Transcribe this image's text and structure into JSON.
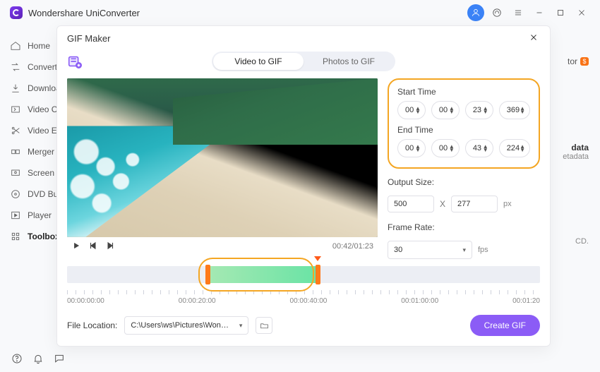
{
  "app": {
    "title": "Wondershare UniConverter"
  },
  "nav": {
    "items": [
      {
        "label": "Home",
        "name": "home"
      },
      {
        "label": "Converter",
        "name": "converter"
      },
      {
        "label": "Downloader",
        "name": "downloader"
      },
      {
        "label": "Video Compressor",
        "name": "video-compressor"
      },
      {
        "label": "Video Editor",
        "name": "video-editor"
      },
      {
        "label": "Merger",
        "name": "merger"
      },
      {
        "label": "Screen Recorder",
        "name": "screen-recorder"
      },
      {
        "label": "DVD Burner",
        "name": "dvd-burner"
      },
      {
        "label": "Player",
        "name": "player"
      },
      {
        "label": "Toolbox",
        "name": "toolbox"
      }
    ],
    "active": 9
  },
  "bg": {
    "editor_suffix": "tor",
    "badge": "$",
    "meta_title_suffix": "data",
    "meta_sub_suffix": "etadata",
    "cd_suffix": "CD."
  },
  "modal": {
    "title": "GIF Maker",
    "tabs": {
      "video": "Video to GIF",
      "photos": "Photos to GIF",
      "active": "video"
    },
    "player": {
      "current": "00:42",
      "total": "01:23"
    },
    "settings": {
      "start_label": "Start Time",
      "end_label": "End Time",
      "start": {
        "h": "00",
        "m": "00",
        "s": "23",
        "ms": "369"
      },
      "end": {
        "h": "00",
        "m": "00",
        "s": "43",
        "ms": "224"
      },
      "output_label": "Output Size:",
      "output": {
        "w": "500",
        "h": "277",
        "unit": "px"
      },
      "frame_label": "Frame Rate:",
      "frame": {
        "value": "30",
        "unit": "fps"
      }
    },
    "timeline": {
      "ticks": [
        "00:00:00:00",
        "00:00:20:00",
        "00:00:40:00",
        "00:01:00:00",
        "00:01:20"
      ]
    },
    "footer": {
      "label": "File Location:",
      "path": "C:\\Users\\ws\\Pictures\\Wonders",
      "create": "Create GIF"
    }
  }
}
